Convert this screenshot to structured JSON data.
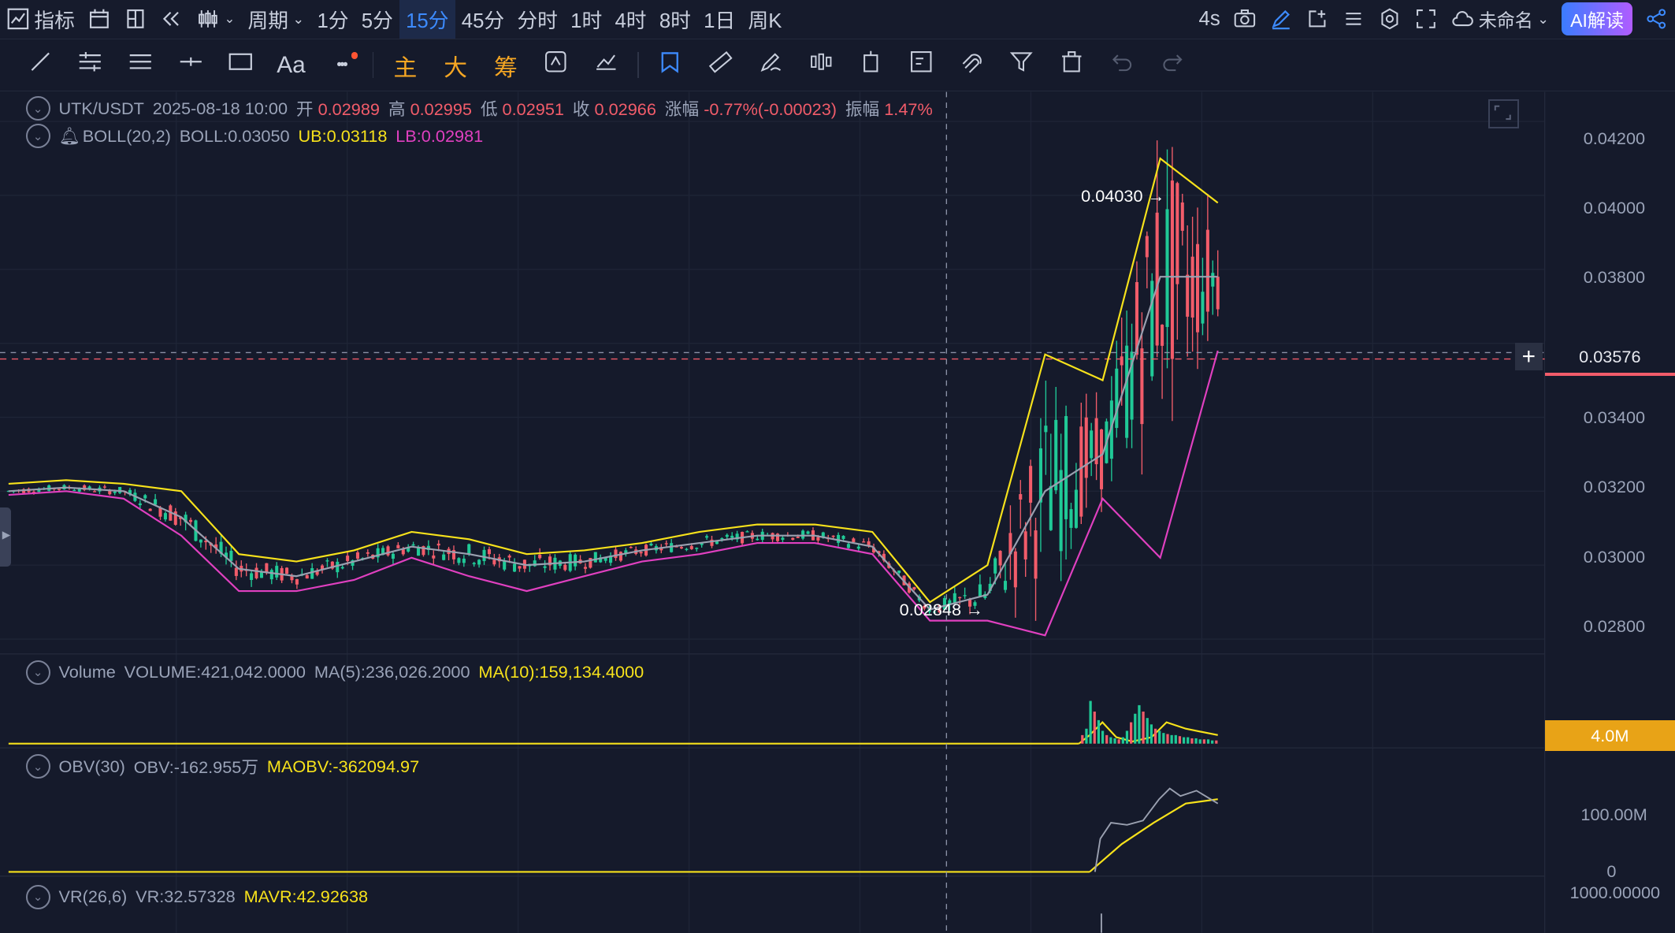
{
  "topbar": {
    "indicators": "指标",
    "period": "周期",
    "intervals": [
      "1分",
      "5分",
      "15分",
      "45分",
      "分时",
      "1时",
      "4时",
      "8时",
      "1日",
      "周K"
    ],
    "active_interval": "15分",
    "refresh": "4s",
    "project_name": "未命名",
    "ai_button": "AI解读"
  },
  "toolbar": {
    "text_tool": "Aa",
    "more": "•••",
    "main_label": "主",
    "big_label": "大",
    "chip_label": "筹"
  },
  "legend_main": {
    "pair": "UTK/USDT",
    "datetime": "2025-08-18 10:00",
    "open_label": "开",
    "open": "0.02989",
    "high_label": "高",
    "high": "0.02995",
    "low_label": "低",
    "low": "0.02951",
    "close_label": "收",
    "close": "0.02966",
    "change_label": "涨幅",
    "change": "-0.77%(-0.00023)",
    "amp_label": "振幅",
    "amp": "1.47%"
  },
  "legend_boll": {
    "name": "BOLL(20,2)",
    "boll": "BOLL:0.03050",
    "ub": "UB:0.03118",
    "lb": "LB:0.02981"
  },
  "legend_volume": {
    "name": "Volume",
    "volume": "VOLUME:421,042.0000",
    "ma5": "MA(5):236,026.2000",
    "ma10": "MA(10):159,134.4000"
  },
  "legend_obv": {
    "name": "OBV(30)",
    "obv": "OBV:-162.955万",
    "maobv": "MAOBV:-362094.97"
  },
  "legend_vr": {
    "name": "VR(26,6)",
    "vr": "VR:32.57328",
    "mavr": "MAVR:42.92638"
  },
  "price_axis": [
    "0.04200",
    "0.04000",
    "0.03800",
    "0.03400",
    "0.03200",
    "0.03000",
    "0.02800"
  ],
  "current_price": "0.03576",
  "volume_axis": "4.0M",
  "obv_axis": [
    "100.00M",
    "0"
  ],
  "vr_axis": "1000.00000",
  "annotations": {
    "max": "0.04030",
    "min": "0.02848"
  },
  "colors": {
    "bg": "#151a2b",
    "up": "#20c997",
    "down": "#f25c6a",
    "ub": "#f7e21b",
    "lb": "#e040c0",
    "mid": "#9aa0b0",
    "accent": "#3d8bff"
  },
  "chart_data": {
    "type": "candlestick",
    "title": "UTK/USDT",
    "interval": "15分",
    "series": [
      {
        "name": "BOLL UB",
        "values": [
          0.0322,
          0.0323,
          0.0322,
          0.032,
          0.0303,
          0.0301,
          0.0304,
          0.0309,
          0.0307,
          0.0303,
          0.0304,
          0.0306,
          0.0309,
          0.0311,
          0.0311,
          0.0309,
          0.029,
          0.03,
          0.0357,
          0.035,
          0.041,
          0.0398
        ]
      },
      {
        "name": "BOLL",
        "values": [
          0.032,
          0.0321,
          0.032,
          0.0313,
          0.0299,
          0.0297,
          0.0301,
          0.0305,
          0.0303,
          0.03,
          0.0301,
          0.0304,
          0.0306,
          0.0308,
          0.0308,
          0.0305,
          0.0288,
          0.0292,
          0.032,
          0.033,
          0.0378,
          0.0378
        ]
      },
      {
        "name": "BOLL LB",
        "values": [
          0.0319,
          0.032,
          0.0318,
          0.0308,
          0.0293,
          0.0293,
          0.0296,
          0.0302,
          0.0297,
          0.0293,
          0.0297,
          0.0301,
          0.0303,
          0.0306,
          0.0306,
          0.0303,
          0.0285,
          0.0285,
          0.0281,
          0.0318,
          0.0302,
          0.0358
        ]
      }
    ],
    "ylim": [
      0.0276,
      0.0428
    ]
  }
}
